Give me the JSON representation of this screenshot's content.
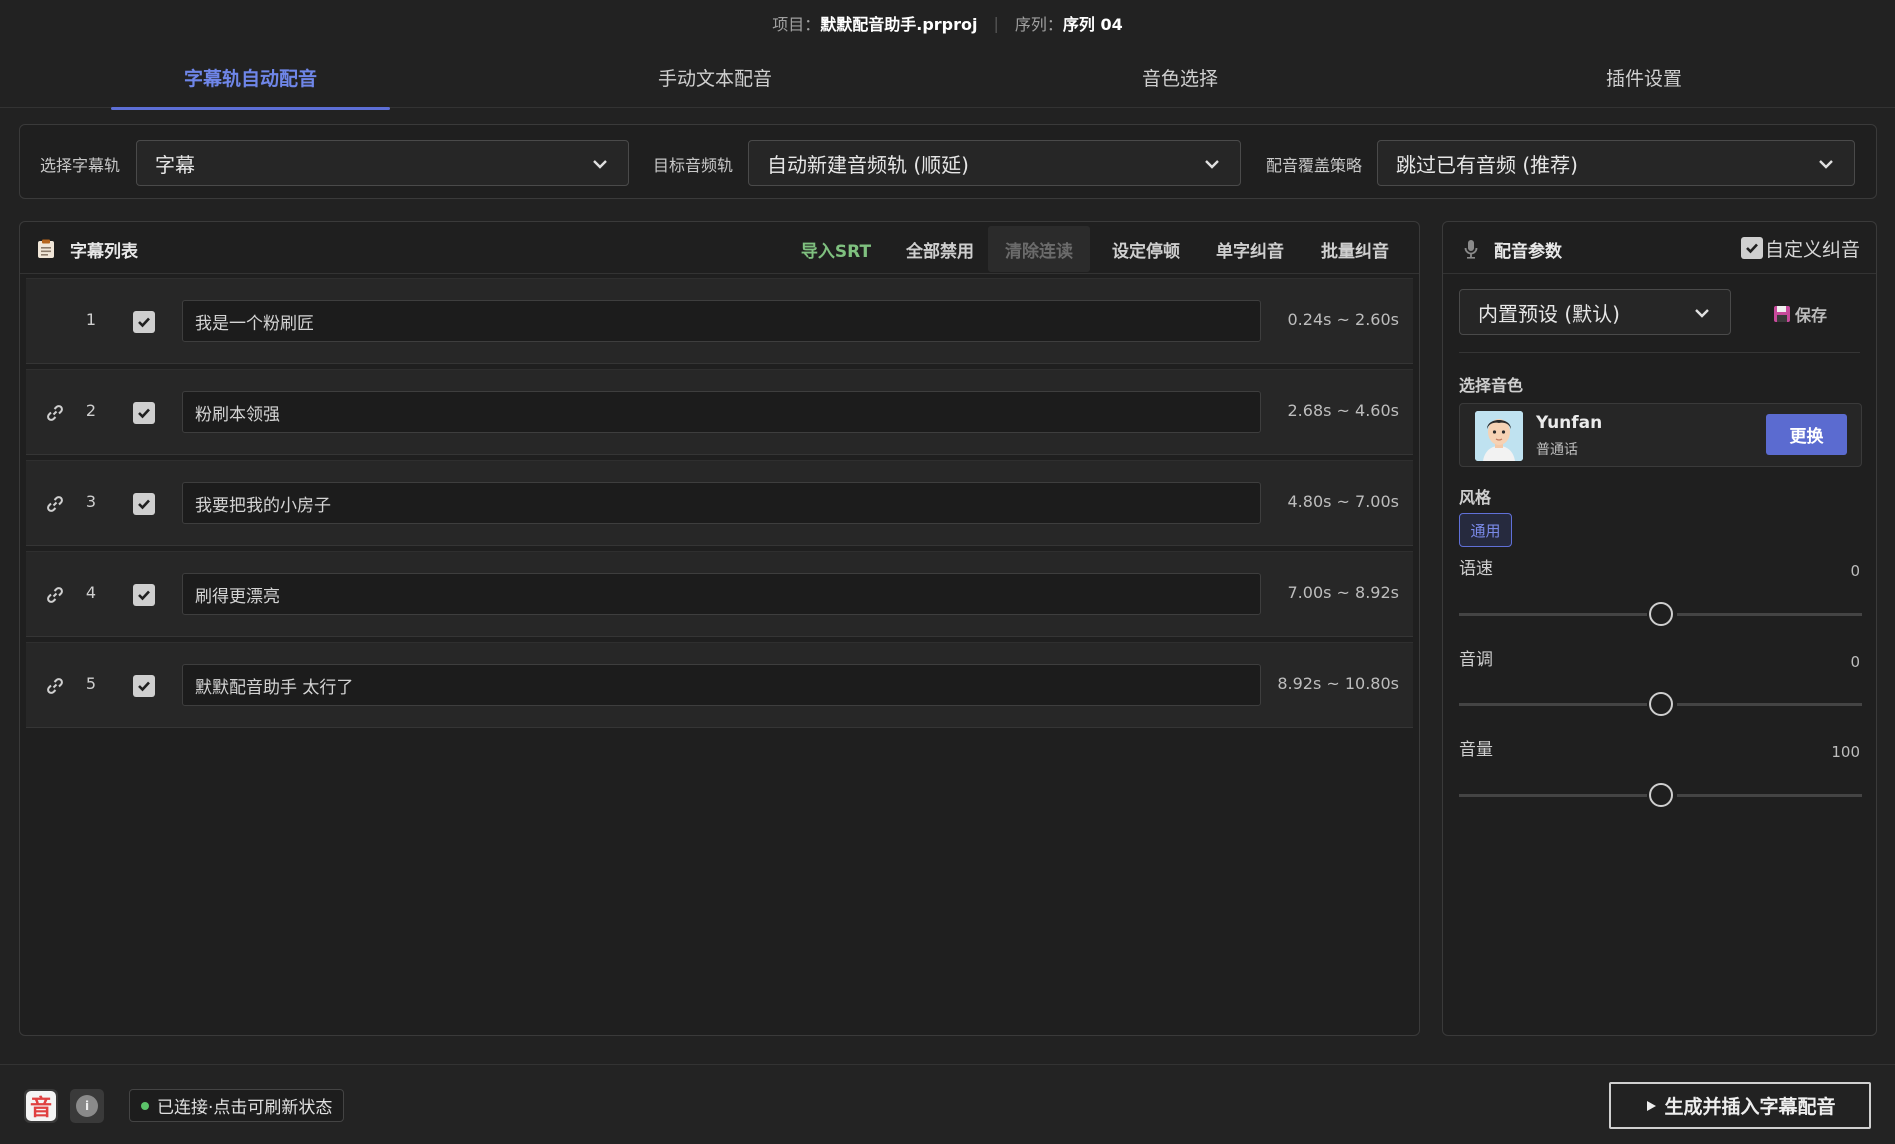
{
  "header": {
    "project_label": "项目：",
    "project_name": "默默配音助手.prproj",
    "separator": "|",
    "sequence_label": "序列：",
    "sequence_name": "序列 04"
  },
  "tabs": [
    {
      "label": "字幕轨自动配音",
      "active": true
    },
    {
      "label": "手动文本配音",
      "active": false
    },
    {
      "label": "音色选择",
      "active": false
    },
    {
      "label": "插件设置",
      "active": false
    }
  ],
  "selectors": {
    "subtitle_track": {
      "label": "选择字幕轨",
      "value": "字幕"
    },
    "audio_track": {
      "label": "目标音频轨",
      "value": "自动新建音频轨 (顺延)"
    },
    "overwrite": {
      "label": "配音覆盖策略",
      "value": "跳过已有音频 (推荐)"
    }
  },
  "subtitle_list": {
    "title": "字幕列表",
    "icon": "clipboard-icon",
    "toolbar": {
      "import_srt": "导入SRT",
      "disable_all": "全部禁用",
      "clear_liaison": "清除连读",
      "set_pause": "设定停顿",
      "single_correct": "单字纠音",
      "batch_correct": "批量纠音"
    },
    "rows": [
      {
        "index": "1",
        "linked": false,
        "checked": true,
        "text": "我是一个粉刷匠",
        "time": "0.24s ~ 2.60s"
      },
      {
        "index": "2",
        "linked": true,
        "checked": true,
        "text": "粉刷本领强",
        "time": "2.68s ~ 4.60s"
      },
      {
        "index": "3",
        "linked": true,
        "checked": true,
        "text": "我要把我的小房子",
        "time": "4.80s ~ 7.00s"
      },
      {
        "index": "4",
        "linked": true,
        "checked": true,
        "text": "刷得更漂亮",
        "time": "7.00s ~ 8.92s"
      },
      {
        "index": "5",
        "linked": true,
        "checked": true,
        "text": "默默配音助手 太行了",
        "time": "8.92s ~ 10.80s"
      }
    ]
  },
  "params": {
    "title": "配音参数",
    "icon": "microphone-icon",
    "custom_correct_label": "自定义纠音",
    "custom_correct_checked": true,
    "preset_value": "内置预设 (默认)",
    "save_label": "保存",
    "voice_section_label": "选择音色",
    "voice": {
      "name": "Yunfan",
      "lang": "普通话",
      "change_label": "更换"
    },
    "style_section_label": "风格",
    "style_tag": "通用",
    "sliders": [
      {
        "label": "语速",
        "value": "0",
        "level": 0.5
      },
      {
        "label": "音调",
        "value": "0",
        "level": 0.5
      },
      {
        "label": "音量",
        "value": "100",
        "level": 0.5
      }
    ]
  },
  "footer": {
    "logo_text": "音",
    "info_glyph": "i",
    "status_text": "已连接·点击可刷新状态",
    "status_color": "#5cc36a",
    "generate_label": "生成并插入字幕配音",
    "generate_icon": "play-icon"
  },
  "colors": {
    "accent": "#5b6bd0",
    "tab_active": "#6f86e8",
    "green": "#7fc07f"
  }
}
